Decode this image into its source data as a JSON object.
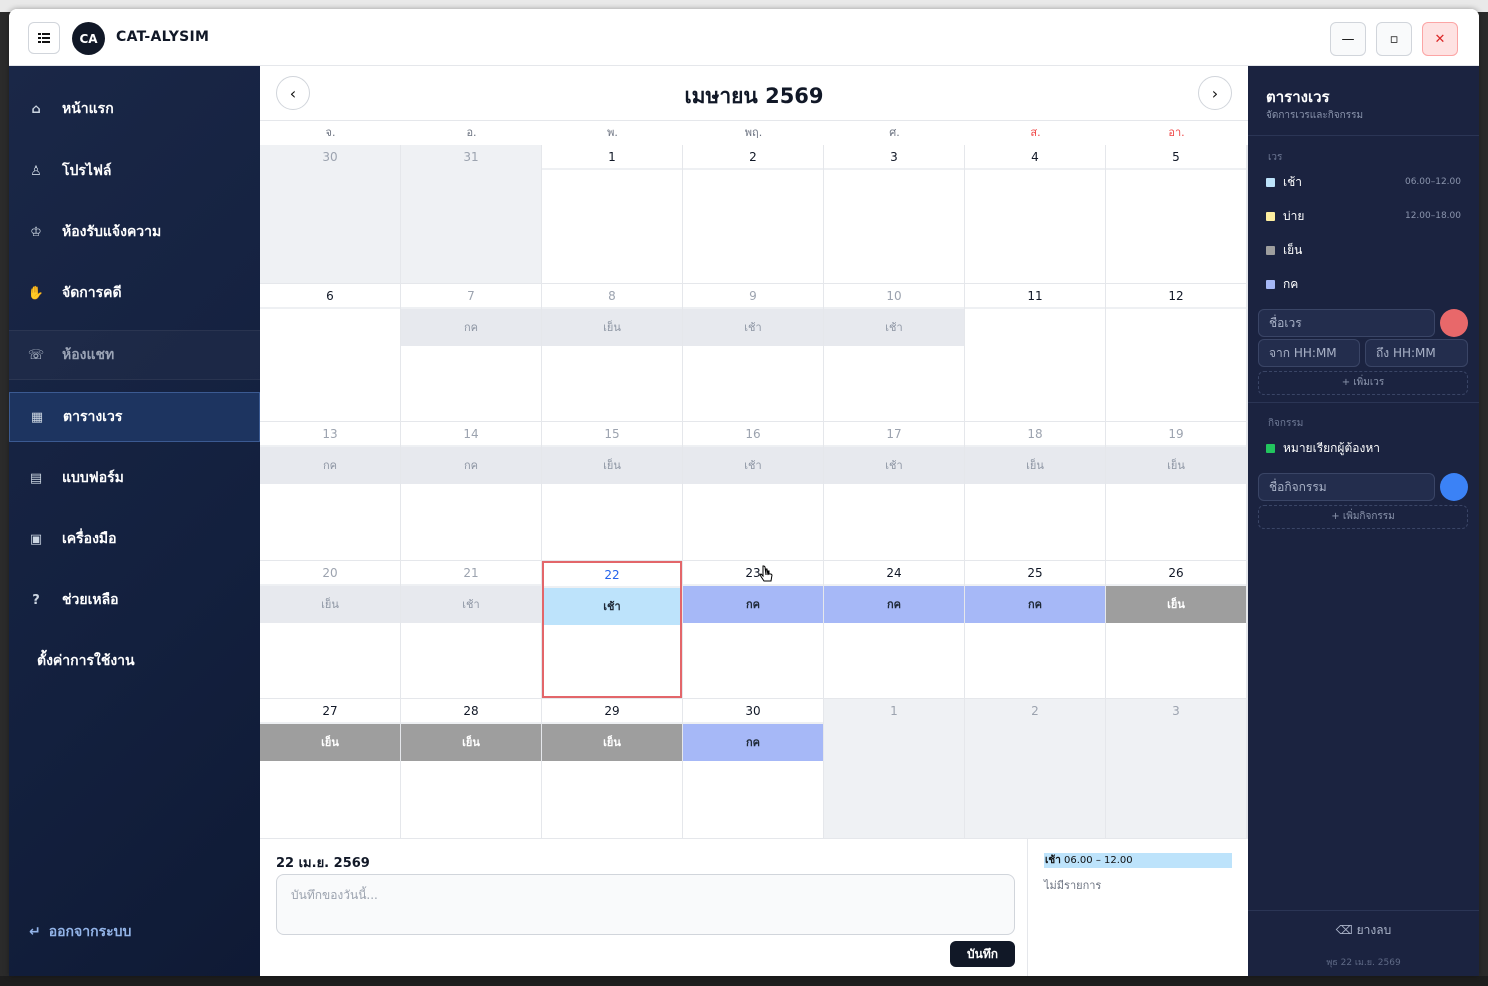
{
  "window": {
    "logo_text": "CA",
    "app_title": "CAT-ALYSIM",
    "menu_icon": "grid-menu-icon",
    "minimize_glyph": "—",
    "maximize_glyph": "▫",
    "close_glyph": "✕"
  },
  "sidebar": {
    "items": [
      {
        "label": "หน้าแรก",
        "icon": "home-icon",
        "glyph": "⌂"
      },
      {
        "label": "โปรไฟล์",
        "icon": "user-icon",
        "glyph": "♙"
      },
      {
        "label": "ห้องรับแจ้งความ",
        "icon": "officer-icon",
        "glyph": "♔"
      },
      {
        "label": "จัดการคดี",
        "icon": "handshake-icon",
        "glyph": "✋"
      },
      {
        "label": "ห้องแชท",
        "icon": "chat-icon",
        "glyph": "☏"
      },
      {
        "label": "ตารางเวร",
        "icon": "calendar-icon",
        "glyph": "▦"
      },
      {
        "label": "แบบฟอร์ม",
        "icon": "form-icon",
        "glyph": "▤"
      },
      {
        "label": "เครื่องมือ",
        "icon": "toolbox-icon",
        "glyph": "▣"
      },
      {
        "label": "ช่วยเหลือ",
        "icon": "help-icon",
        "glyph": "?"
      },
      {
        "label": "ตั้งค่าการใช้งาน",
        "icon": "",
        "glyph": ""
      }
    ],
    "logout_label": "ออกจากระบบ",
    "logout_glyph": "↵"
  },
  "calendar": {
    "month_label": "เมษายน  2569",
    "prev_glyph": "‹",
    "next_glyph": "›",
    "weekdays": [
      "จ.",
      "อ.",
      "พ.",
      "พฤ.",
      "ศ.",
      "ส.",
      "อา."
    ],
    "weeks": [
      [
        {
          "day": "30",
          "state": "out"
        },
        {
          "day": "31",
          "state": "out"
        },
        {
          "day": "1"
        },
        {
          "day": "2"
        },
        {
          "day": "3"
        },
        {
          "day": "4"
        },
        {
          "day": "5"
        }
      ],
      [
        {
          "day": "6"
        },
        {
          "day": "7",
          "state": "dim",
          "shift": "กค",
          "style": "grey"
        },
        {
          "day": "8",
          "state": "dim",
          "shift": "เย็น",
          "style": "grey"
        },
        {
          "day": "9",
          "state": "dim",
          "shift": "เช้า",
          "style": "grey"
        },
        {
          "day": "10",
          "state": "dim",
          "shift": "เช้า",
          "style": "grey"
        },
        {
          "day": "11"
        },
        {
          "day": "12"
        }
      ],
      [
        {
          "day": "13",
          "state": "dim",
          "shift": "กค",
          "style": "grey"
        },
        {
          "day": "14",
          "state": "dim",
          "shift": "กค",
          "style": "grey"
        },
        {
          "day": "15",
          "state": "dim",
          "shift": "เย็น",
          "style": "grey"
        },
        {
          "day": "16",
          "state": "dim",
          "shift": "เช้า",
          "style": "grey"
        },
        {
          "day": "17",
          "state": "dim",
          "shift": "เช้า",
          "style": "grey"
        },
        {
          "day": "18",
          "state": "dim",
          "shift": "เย็น",
          "style": "grey"
        },
        {
          "day": "19",
          "state": "dim",
          "shift": "เย็น",
          "style": "grey"
        }
      ],
      [
        {
          "day": "20",
          "state": "dim",
          "shift": "เย็น",
          "style": "grey"
        },
        {
          "day": "21",
          "state": "dim",
          "shift": "เช้า",
          "style": "grey"
        },
        {
          "day": "22",
          "state": "today",
          "shift": "เช้า",
          "style": "morning"
        },
        {
          "day": "23",
          "shift": "กค",
          "style": "kk"
        },
        {
          "day": "24",
          "shift": "กค",
          "style": "kk"
        },
        {
          "day": "25",
          "shift": "กค",
          "style": "kk"
        },
        {
          "day": "26",
          "shift": "เย็น",
          "style": "evening"
        }
      ],
      [
        {
          "day": "27",
          "shift": "เย็น",
          "style": "evening"
        },
        {
          "day": "28",
          "shift": "เย็น",
          "style": "evening"
        },
        {
          "day": "29",
          "shift": "เย็น",
          "style": "evening"
        },
        {
          "day": "30",
          "shift": "กค",
          "style": "kk"
        },
        {
          "day": "1",
          "state": "out"
        },
        {
          "day": "2",
          "state": "out"
        },
        {
          "day": "3",
          "state": "out"
        }
      ]
    ]
  },
  "day_detail": {
    "date_label": "22 เม.ย. 2569",
    "note_placeholder": "บันทึกของวันนี้...",
    "save_label": "บันทึก",
    "shift_name": "เช้า",
    "shift_time": " 06.00 – 12.00",
    "empty_label": "ไม่มีรายการ"
  },
  "right_panel": {
    "title": "ตารางเวร",
    "subtitle": "จัดการเวรและกิจกรรม",
    "shifts_section": "เวร",
    "shifts": [
      {
        "name": "เช้า",
        "time": "06.00–12.00",
        "color": "#bde3fb"
      },
      {
        "name": "บ่าย",
        "time": "12.00–18.00",
        "color": "#fdeea0"
      },
      {
        "name": "เย็น",
        "time": "",
        "color": "#9e9e9e"
      },
      {
        "name": "กค",
        "time": "",
        "color": "#a6b8f7"
      }
    ],
    "shift_name_placeholder": "ชื่อเวร",
    "from_placeholder": "จาก HH:MM",
    "to_placeholder": "ถึง HH:MM",
    "add_shift_label": "+ เพิ่มเวร",
    "activities_section": "กิจกรรม",
    "activities": [
      {
        "name": "หมายเรียกผู้ต้องหา",
        "color": "#22c55e"
      }
    ],
    "activity_name_placeholder": "ชื่อกิจกรรม",
    "add_activity_label": "+ เพิ่มกิจกรรม",
    "eraser_label": "⌫  ยางลบ",
    "footer_date": "พุธ 22 เม.ย. 2569",
    "shift_color_dot": "#e8686a",
    "activity_color_dot": "#3b82f6"
  },
  "colors": {
    "accent": "#111827",
    "today_border": "#e3666a",
    "weekend_label": "#ef4444"
  }
}
